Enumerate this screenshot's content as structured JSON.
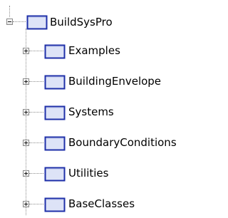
{
  "tree": {
    "root": {
      "label": "BuildSysPro",
      "state": "expanded",
      "icon": "package-icon"
    },
    "children": [
      {
        "label": "Examples",
        "state": "collapsed",
        "icon": "package-icon"
      },
      {
        "label": "BuildingEnvelope",
        "state": "collapsed",
        "icon": "package-icon"
      },
      {
        "label": "Systems",
        "state": "collapsed",
        "icon": "package-icon"
      },
      {
        "label": "BoundaryConditions",
        "state": "collapsed",
        "icon": "package-icon"
      },
      {
        "label": "Utilities",
        "state": "collapsed",
        "icon": "package-icon"
      },
      {
        "label": "BaseClasses",
        "state": "collapsed",
        "icon": "package-icon"
      }
    ]
  },
  "colors": {
    "icon_border": "#1e2fa8",
    "icon_fill": "#dde3f7",
    "connector": "#8c8c8c"
  }
}
